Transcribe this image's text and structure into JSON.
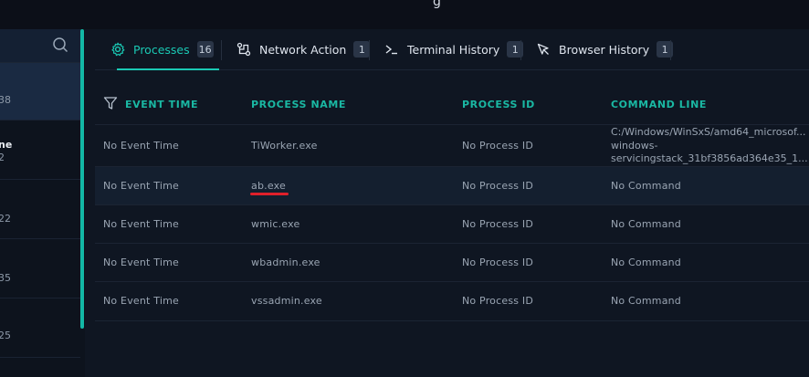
{
  "tabs": [
    {
      "label": "Processes",
      "count": "16",
      "icon": "gear-icon"
    },
    {
      "label": "Network Action",
      "count": "1",
      "icon": "network-icon"
    },
    {
      "label": "Terminal History",
      "count": "1",
      "icon": "terminal-icon"
    },
    {
      "label": "Browser History",
      "count": "1",
      "icon": "cursor-icon"
    }
  ],
  "sidebar": {
    "items": [
      {
        "text": "38"
      },
      {
        "title": "ne",
        "text": "2"
      },
      {
        "text": "22"
      },
      {
        "text": "35"
      },
      {
        "text": "25"
      }
    ]
  },
  "table": {
    "headers": [
      "EVENT TIME",
      "PROCESS NAME",
      "PROCESS ID",
      "COMMAND LINE"
    ],
    "rows": [
      {
        "time": "No Event Time",
        "name": "TiWorker.exe",
        "pid": "No Process ID",
        "cmd_lines": [
          "C:/Windows/WinSxS/amd64_microsof...",
          "windows-",
          "servicingstack_31bf3856ad364e35_1..."
        ]
      },
      {
        "time": "No Event Time",
        "name": "ab.exe",
        "pid": "No Process ID",
        "cmd": "No Command"
      },
      {
        "time": "No Event Time",
        "name": "wmic.exe",
        "pid": "No Process ID",
        "cmd": "No Command"
      },
      {
        "time": "No Event Time",
        "name": "wbadmin.exe",
        "pid": "No Process ID",
        "cmd": "No Command"
      },
      {
        "time": "No Event Time",
        "name": "vssadmin.exe",
        "pid": "No Process ID",
        "cmd": "No Command"
      }
    ]
  },
  "colors": {
    "accent": "#1ac9b4",
    "highlight": "#e0202a"
  }
}
